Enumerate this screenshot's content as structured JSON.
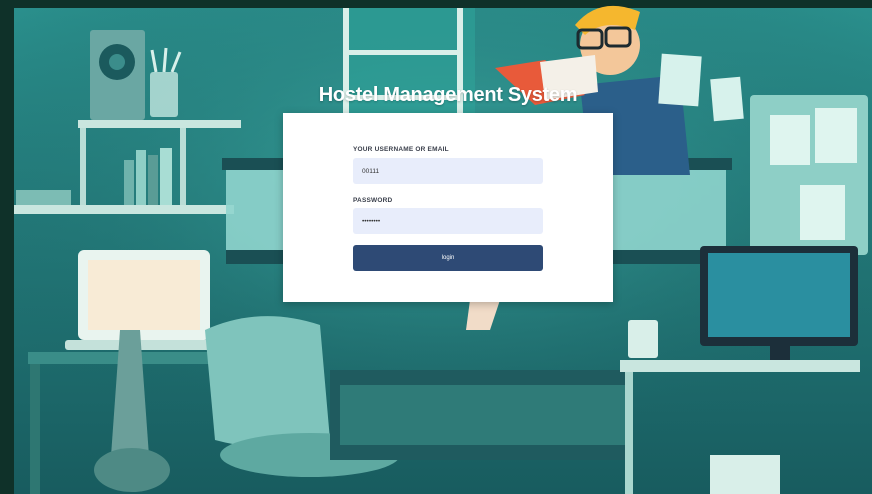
{
  "app": {
    "title": "Hostel Management System"
  },
  "login_form": {
    "username_label": "YOUR USERNAME OR EMAIL",
    "username_value": "00111",
    "password_label": "PASSWORD",
    "password_value": "••••••••",
    "login_button_label": "login"
  },
  "colors": {
    "background": "#1f6f74",
    "card": "#ffffff",
    "input_fill": "#e8edfb",
    "button": "#2e4a75",
    "title_text": "#ffffff"
  }
}
